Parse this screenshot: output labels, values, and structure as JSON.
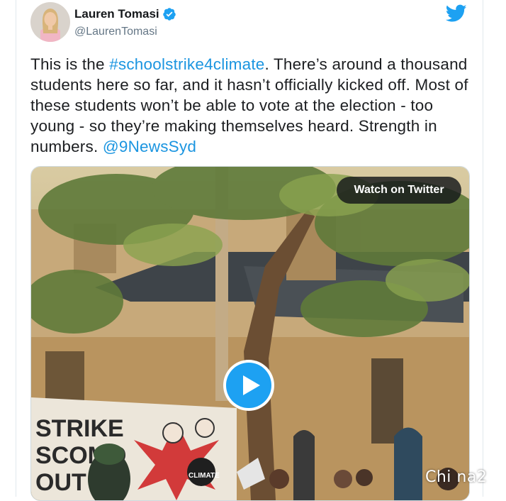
{
  "tweet": {
    "author_name": "Lauren Tomasi",
    "author_handle": "@LaurenTomasi",
    "text_segments": [
      {
        "text": "This is the ",
        "link": false
      },
      {
        "text": "#schoolstrike4climate",
        "link": true
      },
      {
        "text": ". There’s around a thousand students here so far, and it hasn’t officially kicked off. Most of these students won’t be able to vote at the election - too young - so they’re making themselves heard. Strength in numbers. ",
        "link": false
      },
      {
        "text": "@9NewsSyd",
        "link": true
      }
    ]
  },
  "media": {
    "watch_label": "Watch on Twitter",
    "banner_text_left": "STRIKE\nSCOMO\nOUT",
    "sign_text": "CLIMATE STRIKE"
  },
  "watermark": "Chi na2",
  "icons": {
    "verified": "verified-badge-icon",
    "bird": "twitter-bird-icon",
    "play": "play-icon"
  },
  "colors": {
    "link": "#1b95e0",
    "brand": "#1da1f2",
    "text": "#14171a",
    "secondary": "#657786"
  }
}
